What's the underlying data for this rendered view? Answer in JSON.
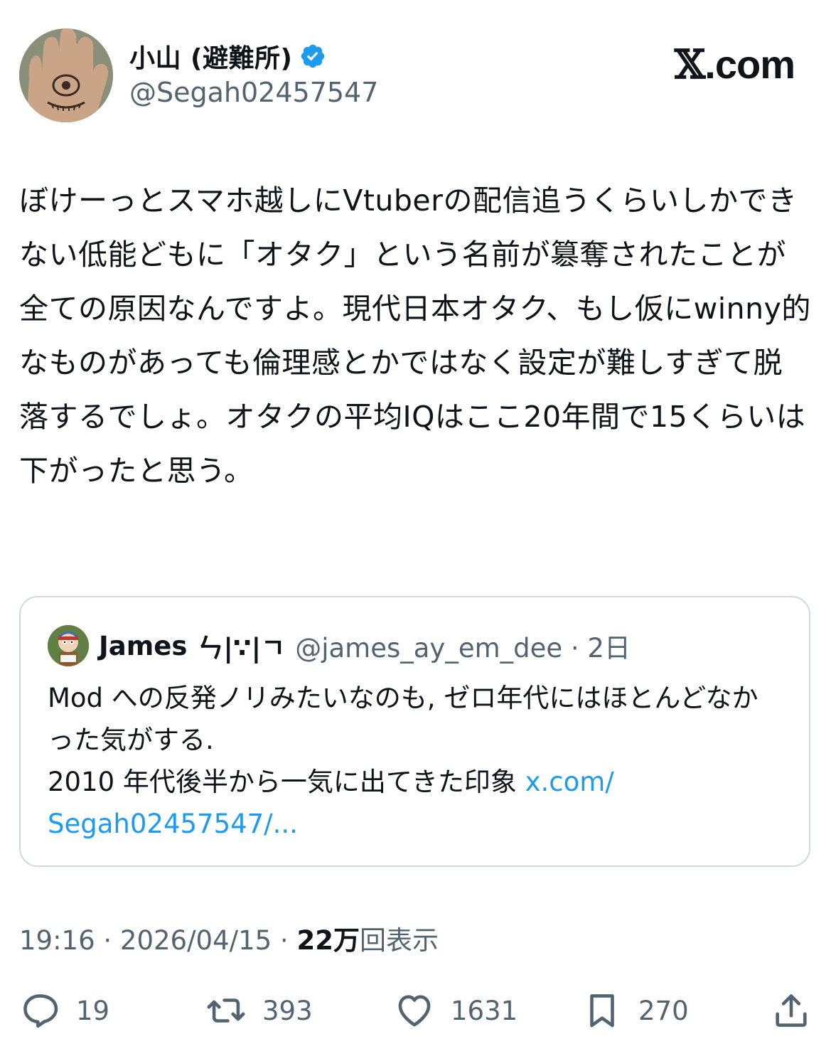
{
  "brand": {
    "logo_mark": "𝕏",
    "logo_text": ".com"
  },
  "author": {
    "display_name": "小山 (避難所)",
    "handle": "@Segah02457547",
    "verified": true,
    "avatar_icon": "hand-eye-avatar"
  },
  "tweet": {
    "text": "ぼけーっとスマホ越しにVtuberの配信追うくらいしかできない低能どもに「オタク」という名前が簒奪されたことが全ての原因なんですよ。現代日本オタク、もし仮にwinny的なものがあっても倫理感とかではなく設定が難しすぎて脱落するでしょ。オタクの平均IQはここ20年間で15くらいは下がったと思う。"
  },
  "quote": {
    "name": "James",
    "name_decoration": "ㄣ|∵|ㄱ",
    "handle_time": "@james_ay_em_dee · 2日",
    "text": "Mod への反発ノリみたいなのも, ゼロ年代にはほとんどなかった気がする.\n2010 年代後半から一気に出てきた印象 ",
    "link": "x.com/\nSegah02457547/...",
    "avatar_icon": "cartoon-avatar"
  },
  "meta": {
    "time_date": "19:16 · 2026/04/15 · ",
    "views_count": "22万",
    "views_label": "回表示"
  },
  "actions": {
    "reply": {
      "icon": "reply-icon",
      "count": "19"
    },
    "retweet": {
      "icon": "retweet-icon",
      "count": "393"
    },
    "like": {
      "icon": "heart-icon",
      "count": "1631"
    },
    "bookmark": {
      "icon": "bookmark-icon",
      "count": "270"
    },
    "share": {
      "icon": "share-icon"
    }
  },
  "colors": {
    "verified": "#1d9bf0",
    "link": "#1d9bf0",
    "secondary_text": "#536471",
    "primary_text": "#0f1419",
    "border": "#cfd9de"
  }
}
